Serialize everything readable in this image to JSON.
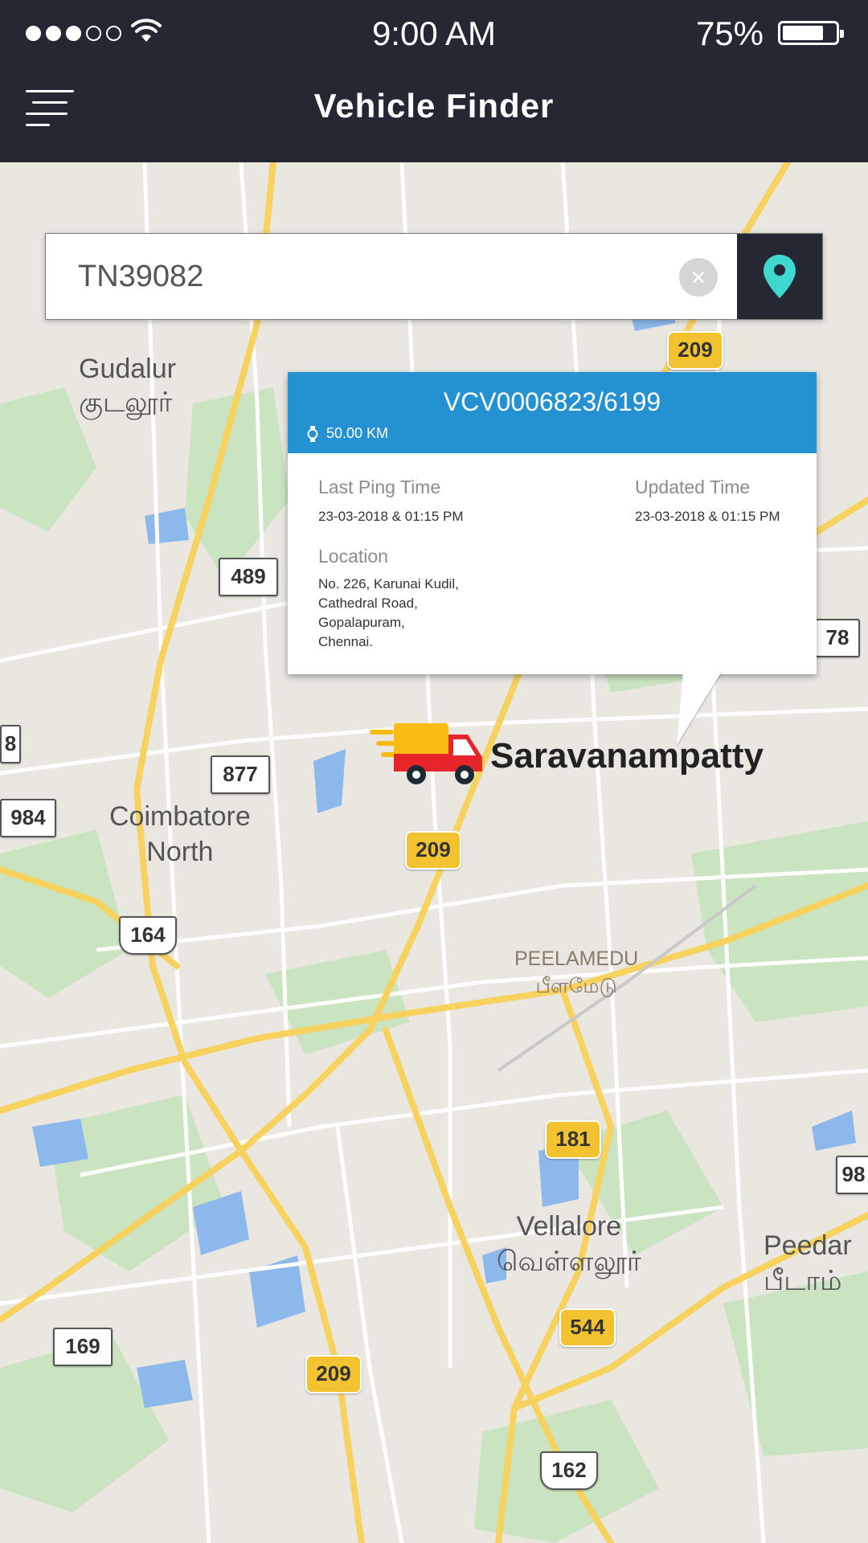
{
  "status_bar": {
    "time": "9:00 AM",
    "battery": "75%",
    "signal_bars": 3,
    "signal_total": 5,
    "battery_level": 0.75
  },
  "app_bar": {
    "title": "Vehicle Finder",
    "menu_icon": "menu-icon"
  },
  "search": {
    "value": "TN39082",
    "clear_icon": "close-icon",
    "locate_icon": "map-pin-icon"
  },
  "colors": {
    "header_bg": "#252833",
    "popup_header": "#2491d3",
    "pin_accent": "#3fd8d0",
    "truck_body": "#e8252b",
    "truck_cargo": "#fbbb12"
  },
  "popup": {
    "vehicle_id": "VCV0006823/6199",
    "distance": "50.00 KM",
    "last_ping_label": "Last Ping Time",
    "last_ping_value": "23-03-2018 & 01:15 PM",
    "updated_label": "Updated Time",
    "updated_value": "23-03-2018 & 01:15 PM",
    "location_label": "Location",
    "address_lines": [
      "No. 226, Karunai Kudil,",
      "Cathedral Road,",
      "Gopalapuram,",
      "Chennai."
    ]
  },
  "map": {
    "vehicle_marker": "truck-icon",
    "vehicle_place": "Saravanampatty",
    "places": [
      {
        "name": "Gudalur",
        "tamil": "குடலூர்"
      },
      {
        "name": "Coimbatore",
        "tamil": "North"
      },
      {
        "name": "PEELAMEDU",
        "tamil": "பீளமேடு"
      },
      {
        "name": "Vellalore",
        "tamil": "வெள்ளலூர்"
      },
      {
        "name": "Peedar",
        "tamil": "பீடாம்"
      }
    ],
    "road_badges": [
      "209",
      "209",
      "209",
      "489",
      "877",
      "984",
      "164",
      "181",
      "544",
      "169",
      "162",
      "78",
      "8",
      "98"
    ]
  }
}
